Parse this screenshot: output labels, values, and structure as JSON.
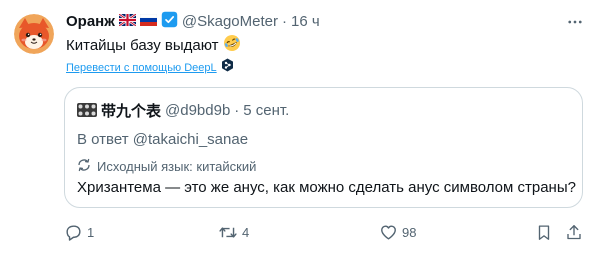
{
  "author": {
    "name": "Оранж",
    "handle": "@SkagoMeter",
    "separator": "·",
    "time": "16 ч",
    "flags": [
      "uk-flag-icon",
      "russia-flag-icon"
    ],
    "verified_icon": "verified-badge-icon",
    "avatar_icon": "orange-fox-avatar-icon"
  },
  "tweet": {
    "text": "Китайцы базу выдают",
    "emoji_icon": "rofl-emoji-icon",
    "translate_label": "Перевести с помощью DeepL",
    "translate_icon": "deepl-icon"
  },
  "quote": {
    "name": "带九个表",
    "handle": "@d9bd9b",
    "separator": "·",
    "time": "5 сент.",
    "reply_to": "В ответ @takaichi_sanae",
    "source_lang": "Исходный язык: китайский",
    "text": "Хризантема — это же анус, как можно сделать анус символом страны?",
    "avatar_icon": "watches-avatar-icon",
    "source_icon": "translate-icon"
  },
  "actions": {
    "reply_count": "1",
    "repost_count": "4",
    "like_count": "98",
    "reply_icon": "reply-icon",
    "repost_icon": "repost-icon",
    "like_icon": "heart-icon",
    "bookmark_icon": "bookmark-icon",
    "share_icon": "share-icon"
  },
  "colors": {
    "accent": "#1d9bf0",
    "text": "#0f1419",
    "muted": "#536471",
    "border": "#cfd9de",
    "avatar_bg": "#e8572a"
  }
}
